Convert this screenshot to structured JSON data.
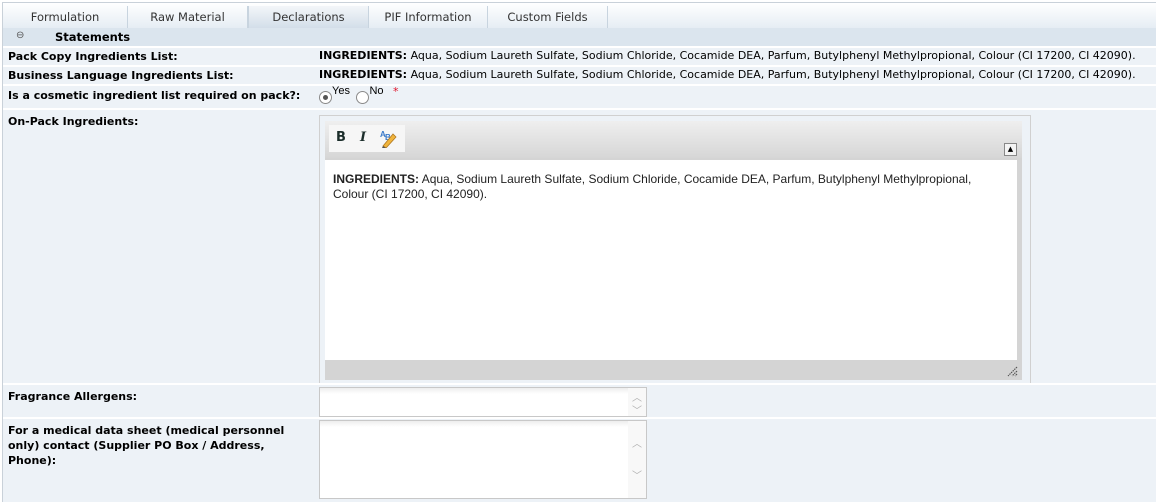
{
  "tabs": [
    {
      "label": "Formulation",
      "active": false
    },
    {
      "label": "Raw Material",
      "active": false
    },
    {
      "label": "Declarations",
      "active": true
    },
    {
      "label": "PIF Information",
      "active": false
    },
    {
      "label": "Custom Fields",
      "active": false
    }
  ],
  "section": {
    "collapse_icon": "⊖",
    "title": "Statements"
  },
  "fields": {
    "pack_copy": {
      "label": "Pack Copy Ingredients List:",
      "prefix": "INGREDIENTS:",
      "value": " Aqua, Sodium Laureth Sulfate, Sodium Chloride, Cocamide DEA, Parfum, Butylphenyl Methylpropional, Colour (CI 17200, CI 42090)."
    },
    "business_language": {
      "label": "Business Language Ingredients List:",
      "prefix": "INGREDIENTS:",
      "value": " Aqua, Sodium Laureth Sulfate, Sodium Chloride, Cocamide DEA, Parfum, Butylphenyl Methylpropional, Colour (CI 17200, CI 42090)."
    },
    "required_on_pack": {
      "label": "Is a cosmetic ingredient list required on pack?:",
      "options": [
        "Yes",
        "No"
      ],
      "selected": "Yes",
      "required_marker": "*"
    },
    "on_pack": {
      "label": "On-Pack Ingredients:",
      "toolbar": {
        "bold": "B",
        "italic": "I"
      },
      "prefix": "INGREDIENTS:",
      "line1": " Aqua, Sodium Laureth Sulfate, Sodium Chloride, Cocamide DEA, Parfum, Butylphenyl Methylpropional,",
      "line2": "Colour (CI 17200, CI 42090)."
    },
    "fragrance_allergens": {
      "label": "Fragrance Allergens:",
      "value": ""
    },
    "medical_contact": {
      "label_lines": [
        "For a medical data sheet (medical personnel",
        "only) contact (Supplier PO Box / Address,",
        "Phone):"
      ],
      "value": ""
    }
  },
  "colors": {
    "panel_bg": "#edf2f7",
    "section_bg": "#dbe5ee",
    "required": "#e0142a"
  }
}
